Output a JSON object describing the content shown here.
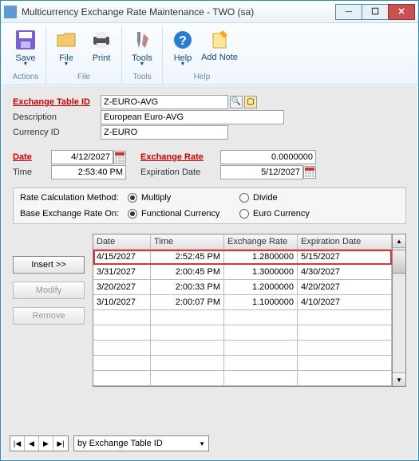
{
  "window": {
    "title": "Multicurrency Exchange Rate Maintenance  -  TWO (sa)"
  },
  "ribbon": {
    "save": "Save",
    "file": "File",
    "print": "Print",
    "tools": "Tools",
    "help": "Help",
    "addnote": "Add Note",
    "grp_actions": "Actions",
    "grp_file": "File",
    "grp_tools": "Tools",
    "grp_help": "Help"
  },
  "form": {
    "exchange_table_id_label": "Exchange Table ID",
    "exchange_table_id": "Z-EURO-AVG",
    "description_label": "Description",
    "description": "European Euro-AVG",
    "currency_id_label": "Currency ID",
    "currency_id": "Z-EURO",
    "date_label": "Date",
    "date": "4/12/2027",
    "time_label": "Time",
    "time": "2:53:40 PM",
    "exchange_rate_label": "Exchange Rate",
    "exchange_rate": "0.0000000",
    "expiration_date_label": "Expiration Date",
    "expiration_date": "5/12/2027"
  },
  "radios": {
    "calc_label": "Rate Calculation Method:",
    "multiply": "Multiply",
    "divide": "Divide",
    "base_label": "Base Exchange Rate On:",
    "functional": "Functional Currency",
    "euro": "Euro Currency"
  },
  "buttons": {
    "insert": "Insert >>",
    "modify": "Modify",
    "remove": "Remove"
  },
  "table": {
    "headers": {
      "date": "Date",
      "time": "Time",
      "rate": "Exchange Rate",
      "exp": "Expiration Date"
    },
    "rows": [
      {
        "date": "4/15/2027",
        "time": "2:52:45 PM",
        "rate": "1.2800000",
        "exp": "5/15/2027",
        "hl": true
      },
      {
        "date": "3/31/2027",
        "time": "2:00:45 PM",
        "rate": "1.3000000",
        "exp": "4/30/2027"
      },
      {
        "date": "3/20/2027",
        "time": "2:00:33 PM",
        "rate": "1.2000000",
        "exp": "4/20/2027"
      },
      {
        "date": "3/10/2027",
        "time": "2:00:07 PM",
        "rate": "1.1000000",
        "exp": "4/10/2027"
      }
    ]
  },
  "nav": {
    "sort_by": "by Exchange Table ID"
  }
}
